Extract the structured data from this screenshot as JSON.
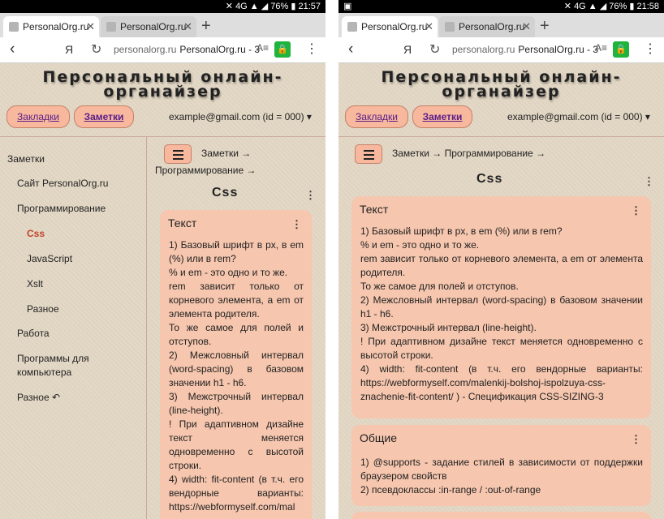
{
  "status_left": {
    "time": "21:57",
    "battery": "76%",
    "network": "4G"
  },
  "status_right": {
    "time": "21:58",
    "battery": "76%",
    "network": "4G"
  },
  "browser": {
    "tab_active": "PersonalOrg.ru",
    "tab_inactive": "PersonalOrg.ru",
    "url_host": "personalorg.ru",
    "url_title": "PersonalOrg.ru - 3",
    "yandex": "Я"
  },
  "site": {
    "title_line1": "Персональный онлайн-",
    "title_line2": "органайзер",
    "bookmarks_btn": "Закладки",
    "notes_btn": "Заметки",
    "email": "example@gmail.com (id = 000) ▾"
  },
  "sidebar": {
    "items": [
      {
        "label": "Заметки"
      },
      {
        "label": "Сайт PersonalOrg.ru"
      },
      {
        "label": "Программирование"
      },
      {
        "label": "Css"
      },
      {
        "label": "JavaScript"
      },
      {
        "label": "Xslt"
      },
      {
        "label": "Разное"
      },
      {
        "label": "Работа"
      },
      {
        "label": "Программы для компьютера"
      },
      {
        "label": "Разное ↶"
      }
    ]
  },
  "breadcrumb": {
    "line1": "Заметки →",
    "line2": "Программирование →",
    "full": "Заметки → Программирование →"
  },
  "page_title": "Css",
  "card_text": {
    "title": "Текст",
    "lines": [
      "1) Базовый шрифт в px, в em (%) или в rem?",
      "% и em - это одно и то же.",
      "rem зависит только от корневого элемента, а em от элемента родителя.",
      "То же самое для полей и отступов.",
      "2) Межсловный интервал (word-spacing) в базовом значении h1 - h6.",
      "3) Межстрочный интервал (line-height).",
      "! При адаптивном дизайне текст меняется одновременно с высотой строки.",
      "4) width: fit-content (в т.ч. его вендорные варианты: https://webformyself.com/malenkij-bolshoj-ispolzuya-css-znachenie-fit-content/ ) - Спецификация CSS-SIZING-3"
    ],
    "left_visible_tail": "4) width: fit-content (в т.ч. его вендорные варианты: https://webformyself.com/mal"
  },
  "card_general": {
    "title": "Общие",
    "lines": [
      "1) @supports - задание стилей в зависимости от поддержки браузером свойств",
      "2) псевдоклассы :in-range / :out-of-range"
    ]
  },
  "icons": {
    "back": "back-arrow-icon",
    "reload": "reload-icon",
    "reader": "reader-mode-icon",
    "lock": "lock-icon",
    "menu": "kebab-menu-icon",
    "hamburger": "hamburger-icon"
  },
  "colors": {
    "button_bg": "#f7b89d",
    "card_bg": "#f6c6ae",
    "active_link": "#c0432a",
    "lock_green": "#1fb43c"
  }
}
